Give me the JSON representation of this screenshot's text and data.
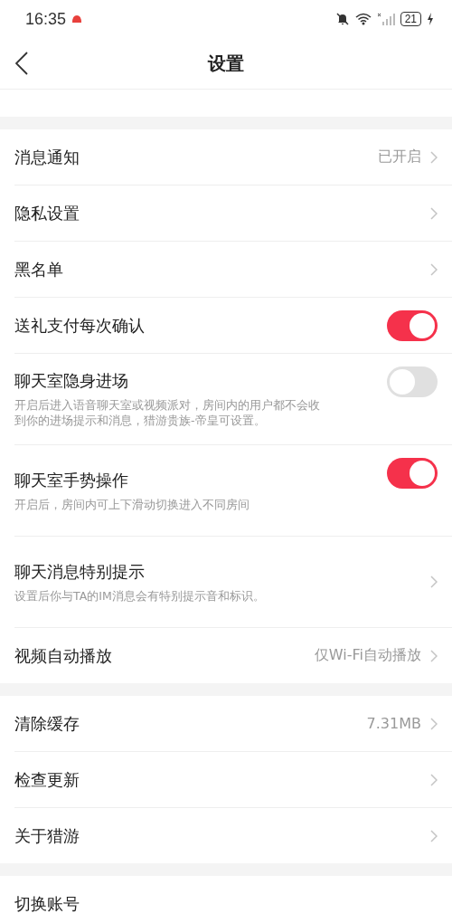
{
  "status_bar": {
    "time": "16:35",
    "battery": "21"
  },
  "header": {
    "title": "设置"
  },
  "sections": [
    {
      "items": [
        {
          "kind": "link",
          "label": "消息通知",
          "value": "已开启"
        },
        {
          "kind": "link",
          "label": "隐私设置"
        },
        {
          "kind": "link",
          "label": "黑名单"
        },
        {
          "kind": "toggle",
          "label": "送礼支付每次确认",
          "on": true
        },
        {
          "kind": "toggle",
          "label": "聊天室隐身进场",
          "description": "开启后进入语音聊天室或视频派对，房间内的用户都不会收到你的进场提示和消息，猎游贵族-帝皇可设置。",
          "on": false
        },
        {
          "kind": "toggle",
          "label": "聊天室手势操作",
          "description": "开启后，房间内可上下滑动切换进入不同房间",
          "on": true
        },
        {
          "kind": "link",
          "label": "聊天消息特别提示",
          "description": "设置后你与TA的IM消息会有特别提示音和标识。"
        },
        {
          "kind": "link",
          "label": "视频自动播放",
          "value": "仅Wi-Fi自动播放"
        }
      ]
    },
    {
      "items": [
        {
          "kind": "link",
          "label": "清除缓存",
          "value": "7.31MB"
        },
        {
          "kind": "link",
          "label": "检查更新"
        },
        {
          "kind": "link",
          "label": "关于猎游"
        }
      ]
    },
    {
      "items": [
        {
          "kind": "plain",
          "label": "切换账号"
        }
      ]
    }
  ]
}
